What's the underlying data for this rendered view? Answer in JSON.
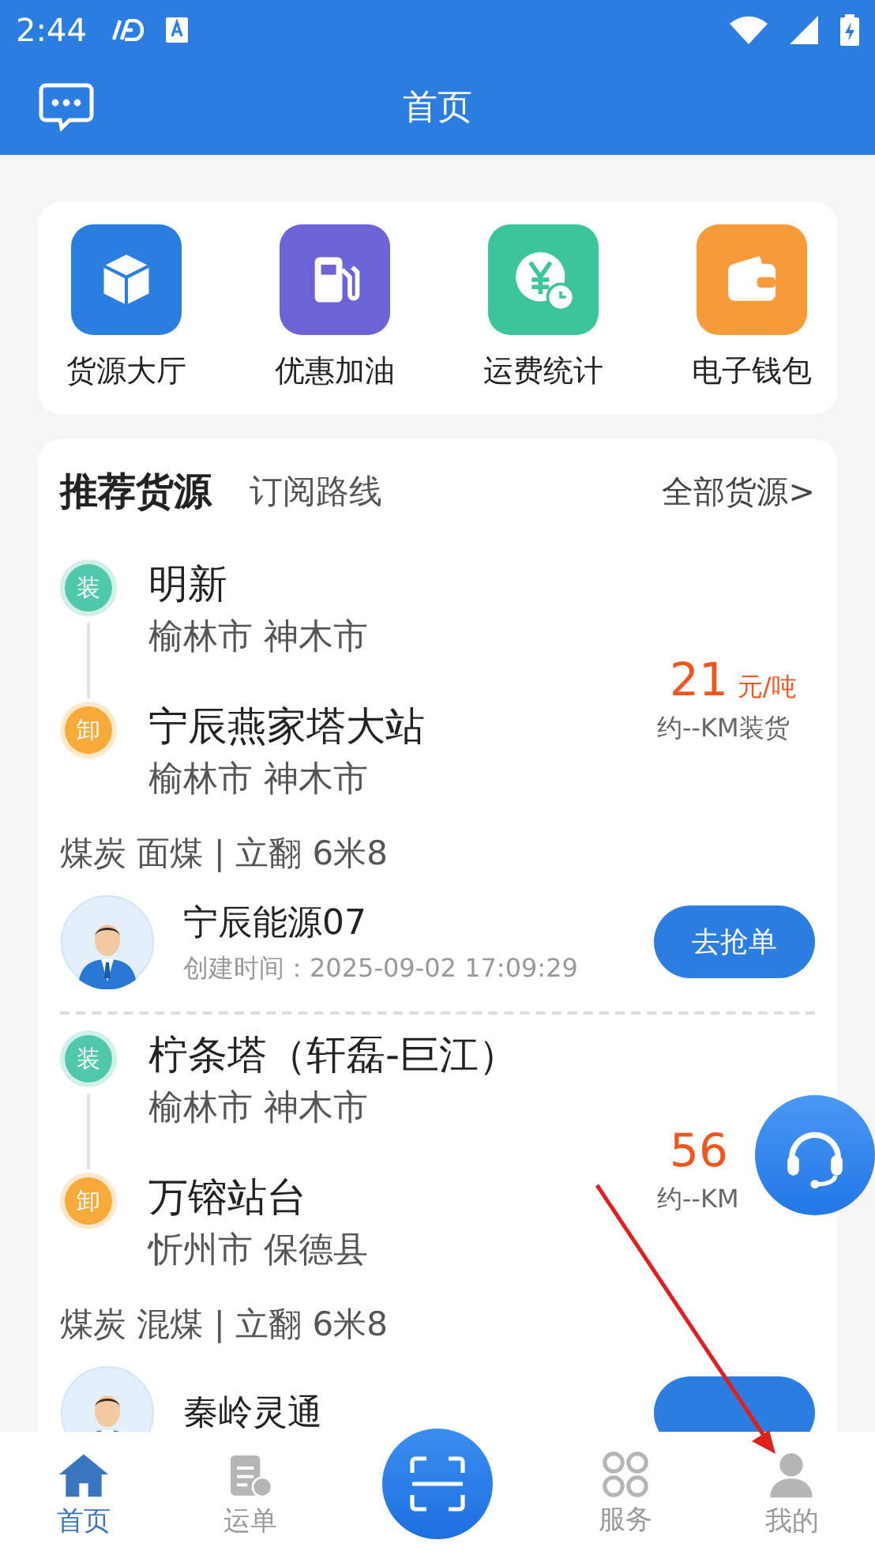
{
  "status_bar": {
    "time": "2:44"
  },
  "header": {
    "title": "首页"
  },
  "quick_menu": [
    {
      "kind": "cargo",
      "label": "货源大厅",
      "color": "#2a7de1"
    },
    {
      "kind": "fuel",
      "label": "优惠加油",
      "color": "#6b63d6"
    },
    {
      "kind": "fee",
      "label": "运费统计",
      "color": "#3cc49a"
    },
    {
      "kind": "wallet",
      "label": "电子钱包",
      "color": "#f79a3a"
    }
  ],
  "recommend": {
    "tabs": [
      {
        "label": "推荐货源",
        "selected": true
      },
      {
        "label": "订阅路线",
        "selected": false
      }
    ],
    "all_link": "全部货源>"
  },
  "orders": [
    {
      "load": {
        "badge": "装",
        "name": "明新",
        "area": "榆林市 神木市"
      },
      "unload": {
        "badge": "卸",
        "name": "宁辰燕家塔大站",
        "area": "榆林市 神木市"
      },
      "price": "21",
      "unit": "元/吨",
      "distance": "约--KM装货",
      "goods": "煤炭 面煤 | 立翻 6米8",
      "shipper": "宁辰能源07",
      "created": "创建时间：2025-09-02 17:09:29",
      "action": "去抢单"
    },
    {
      "load": {
        "badge": "装",
        "name": "柠条塔（轩磊-巨江）",
        "area": "榆林市 神木市"
      },
      "unload": {
        "badge": "卸",
        "name": "万镕站台",
        "area": "忻州市 保德县"
      },
      "price": "56",
      "distance": "约--KM",
      "goods": "煤炭 混煤 | 立翻 6米8",
      "shipper": "秦岭灵通"
    }
  ],
  "nav": [
    {
      "kind": "home",
      "label": "首页",
      "selected": true
    },
    {
      "kind": "waybill",
      "label": "运单",
      "selected": false
    },
    {
      "kind": "scan"
    },
    {
      "kind": "service",
      "label": "服务",
      "selected": false
    },
    {
      "kind": "mine",
      "label": "我的",
      "selected": false
    }
  ]
}
